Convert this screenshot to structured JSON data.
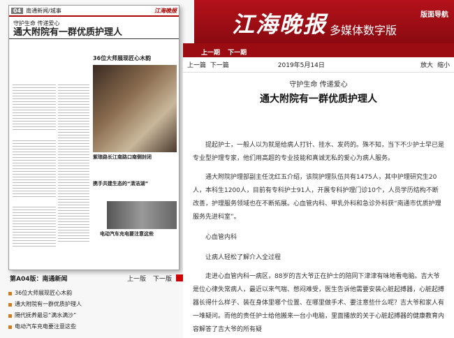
{
  "header": {
    "brand": "江海晚报",
    "brand_sub": "多媒体数字版",
    "nav": "版面导航"
  },
  "paper": {
    "page_num": "04",
    "section": "南通新闻/城事",
    "kicker": "守护生命 传递爱心",
    "headline": "通大附院有一群优质护理人",
    "sub1": "36位大师展现匠心木韵",
    "sub2": "紫琅路长江南路口南侧封闭",
    "sub3": "携手共建生态的“清洁湖”",
    "sub4": "电动汽车充电要注意这些"
  },
  "footer": {
    "section": "第A04版：南通新闻",
    "prev": "上一版",
    "next": "下一版"
  },
  "toc": [
    "36位大师展现匠心木韵",
    "通大附院有一群优质护理人",
    "隔代抚养最忌“满水满沙”",
    "电动汽车充电要注意这些"
  ],
  "issue": {
    "prev": "上一期",
    "next": "下一期"
  },
  "tool": {
    "prev": "上一篇",
    "next": "下一篇",
    "date": "2019年5月14日",
    "zoom_in": "放大",
    "zoom_out": "缩小"
  },
  "article": {
    "kicker": "守护生命 传递爱心",
    "title": "通大附院有一群优质护理人",
    "p1": "提起护士，一般人以为就是给病人打针、挂水、发药的。殊不知，当下不少护士早已是专业型护理专家，他们用高超的专业技能和真诚无私的爱心为病人服务。",
    "p2": "通大附院护理部副主任沈红五介绍，该院护理队伍共有1475人，其中护理研究生20人，本科生1200人，目前有专科护士91人，开展专科护理门诊10个，人员学历结构不断改善，护理服务领域也在不断拓展。心血管内科、甲乳外科和急诊外科获“南通市优质护理服务先进科室”。",
    "h1": "心血管内科",
    "h2": "让病人轻松了解介入全过程",
    "p3": "走进心血管内科一病区，88岁的吉大爷正在护士的陪同下津津有味地看电脑。吉大爷是位心律失常病人，最近以来气喘、憋闷难受，医生告诉他需要安装心脏起搏器，心脏起搏器长得什么样子、装在身体里哪个位置、在哪里做手术、要注意些什么呢？吉大爷和家人有一堆疑问。而他的责任护士给他搬来一台小电脑，里面播放的关于心脏起搏器的健康教育内容解答了吉大爷的所有疑"
  }
}
